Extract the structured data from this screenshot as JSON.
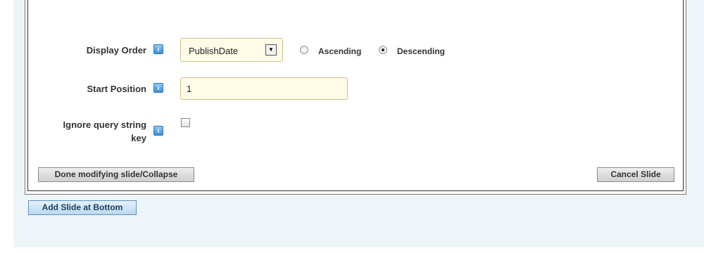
{
  "form": {
    "display_order": {
      "label": "Display Order",
      "help_icon": "help-icon",
      "select_value": "PublishDate",
      "sort_options": [
        {
          "label": "Ascending",
          "checked": false
        },
        {
          "label": "Descending",
          "checked": true
        }
      ]
    },
    "start_position": {
      "label": "Start Position",
      "help_icon": "help-icon",
      "value": "1"
    },
    "ignore_query": {
      "label_line1": "Ignore query string",
      "label_line2": "key",
      "help_icon": "help-icon",
      "checked": false
    }
  },
  "buttons": {
    "done": "Done modifying slide/Collapse",
    "cancel": "Cancel Slide",
    "add_slide": "Add Slide at Bottom"
  },
  "colors": {
    "panel_bg": "#eef5f8",
    "input_bg": "#fffbe6",
    "accent_blue": "#3b8fd8"
  }
}
